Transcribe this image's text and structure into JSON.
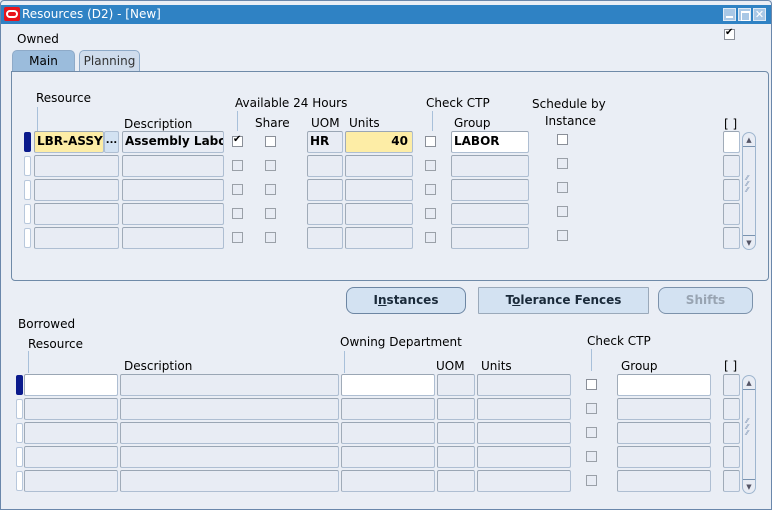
{
  "window": {
    "title": "Resources (D2) - [New]",
    "controls": [
      "minimize",
      "maximize",
      "close"
    ]
  },
  "owned_label": "Owned",
  "owned_checked": true,
  "tabs": [
    {
      "label": "Main",
      "active": true
    },
    {
      "label": "Planning",
      "active": false
    }
  ],
  "owned_table": {
    "headers": {
      "resource": "Resource",
      "description": "Description",
      "available_24_hours": "Available 24 Hours",
      "share": "Share",
      "uom": "UOM",
      "units": "Units",
      "check_ctp": "Check CTP",
      "group": "Group",
      "schedule_by_instance_1": "Schedule by",
      "schedule_by_instance_2": "Instance",
      "folder": "[ ]"
    },
    "rows": [
      {
        "resource": "LBR-ASSY",
        "description": "Assembly Labo",
        "available_24": true,
        "share": false,
        "uom": "HR",
        "units": "40",
        "check_ctp": false,
        "group": "LABOR",
        "schedule_by_instance": false,
        "current": true
      },
      {
        "resource": "",
        "description": "",
        "available_24": false,
        "share": false,
        "uom": "",
        "units": "",
        "check_ctp": false,
        "group": "",
        "schedule_by_instance": false,
        "current": false
      },
      {
        "resource": "",
        "description": "",
        "available_24": false,
        "share": false,
        "uom": "",
        "units": "",
        "check_ctp": false,
        "group": "",
        "schedule_by_instance": false,
        "current": false
      },
      {
        "resource": "",
        "description": "",
        "available_24": false,
        "share": false,
        "uom": "",
        "units": "",
        "check_ctp": false,
        "group": "",
        "schedule_by_instance": false,
        "current": false
      },
      {
        "resource": "",
        "description": "",
        "available_24": false,
        "share": false,
        "uom": "",
        "units": "",
        "check_ctp": false,
        "group": "",
        "schedule_by_instance": false,
        "current": false
      }
    ],
    "lov_button": "..."
  },
  "buttons": {
    "instances": {
      "pre": "I",
      "accel": "n",
      "post": "stances"
    },
    "tolerance_fences": {
      "pre": "T",
      "accel": "o",
      "post": "lerance Fences"
    },
    "shifts": {
      "label": "Shifts",
      "enabled": false
    }
  },
  "borrowed_label": "Borrowed",
  "borrowed_table": {
    "headers": {
      "resource": "Resource",
      "description": "Description",
      "owning_department": "Owning Department",
      "uom": "UOM",
      "units": "Units",
      "check_ctp": "Check CTP",
      "group": "Group",
      "folder": "[ ]"
    },
    "rows": [
      {
        "resource": "",
        "description": "",
        "owning_department": "",
        "uom": "",
        "units": "",
        "check_ctp": false,
        "group": "",
        "current": true
      },
      {
        "resource": "",
        "description": "",
        "owning_department": "",
        "uom": "",
        "units": "",
        "check_ctp": false,
        "group": "",
        "current": false
      },
      {
        "resource": "",
        "description": "",
        "owning_department": "",
        "uom": "",
        "units": "",
        "check_ctp": false,
        "group": "",
        "current": false
      },
      {
        "resource": "",
        "description": "",
        "owning_department": "",
        "uom": "",
        "units": "",
        "check_ctp": false,
        "group": "",
        "current": false
      },
      {
        "resource": "",
        "description": "",
        "owning_department": "",
        "uom": "",
        "units": "",
        "check_ctp": false,
        "group": "",
        "current": false
      }
    ]
  },
  "colors": {
    "titlebar": "#2f82c4",
    "current_field": "#fdeda6",
    "record_indicator": "#0a1a8c"
  }
}
